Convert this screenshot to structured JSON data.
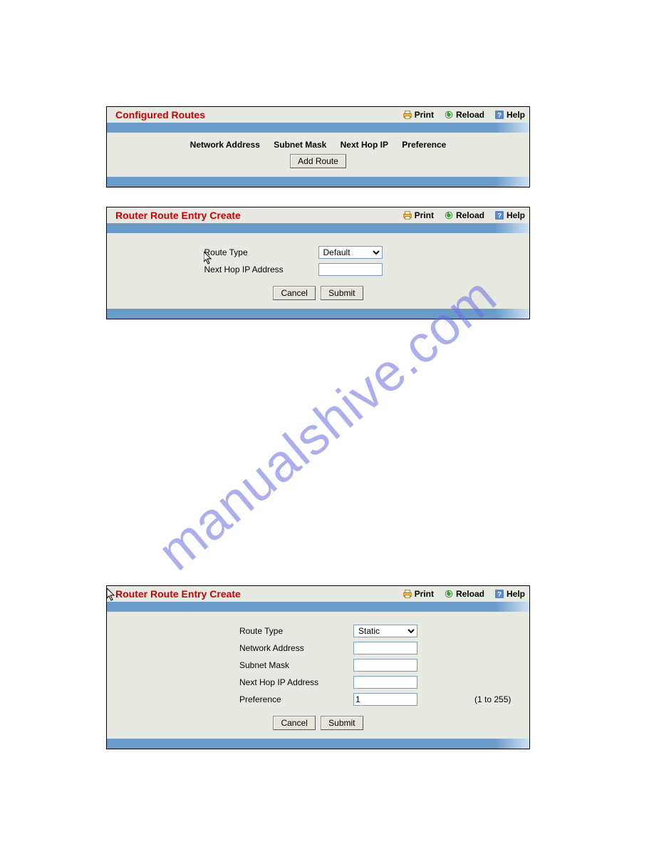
{
  "watermark": "manualshive.com",
  "actions": {
    "print": "Print",
    "reload": "Reload",
    "help": "Help"
  },
  "panel1": {
    "title": "Configured Routes",
    "columns": [
      "Network Address",
      "Subnet Mask",
      "Next Hop IP",
      "Preference"
    ],
    "add_route": "Add Route"
  },
  "panel2": {
    "title": "Router Route Entry Create",
    "fields": {
      "route_type": "Route Type",
      "next_hop": "Next Hop IP Address"
    },
    "route_type_value": "Default",
    "cancel": "Cancel",
    "submit": "Submit"
  },
  "panel3": {
    "title": "Router Route Entry Create",
    "fields": {
      "route_type": "Route Type",
      "network_address": "Network Address",
      "subnet_mask": "Subnet Mask",
      "next_hop": "Next Hop IP Address",
      "preference": "Preference"
    },
    "route_type_value": "Static",
    "preference_value": "1",
    "preference_hint": "(1 to 255)",
    "cancel": "Cancel",
    "submit": "Submit"
  }
}
